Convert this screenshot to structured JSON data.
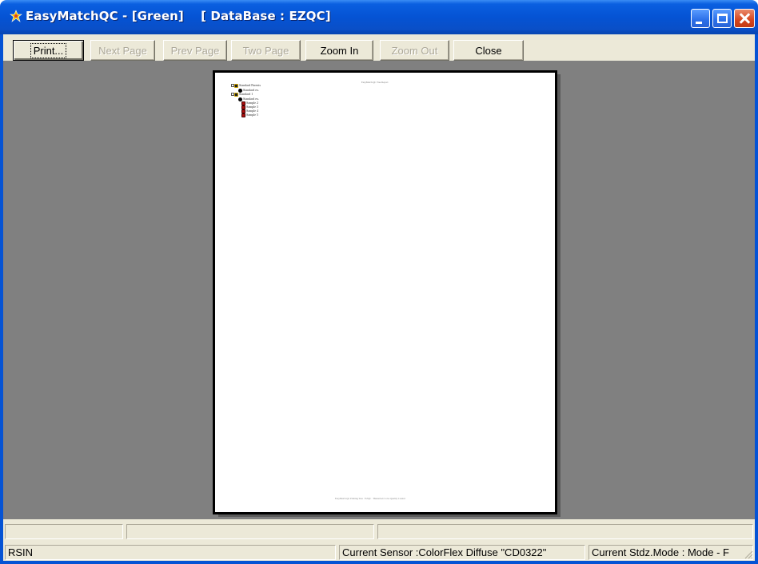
{
  "window": {
    "title": "EasyMatchQC - [Green]    [ DataBase : EZQC]",
    "app_icon": "easymatch-app-icon",
    "controls": {
      "minimize": "minimize-icon",
      "maximize": "maximize-icon",
      "close": "close-icon"
    }
  },
  "toolbar": {
    "buttons": [
      {
        "label": "Print...",
        "enabled": true,
        "focused": true
      },
      {
        "label": "Next Page",
        "enabled": false
      },
      {
        "label": "Prev Page",
        "enabled": false
      },
      {
        "label": "Two Page",
        "enabled": false
      },
      {
        "label": "Zoom In",
        "enabled": true
      },
      {
        "label": "Zoom Out",
        "enabled": false
      },
      {
        "label": "Close",
        "enabled": true
      }
    ]
  },
  "preview": {
    "page": {
      "header": "EasyMatch QC Tree Report",
      "footer": "EasyMatch QC Printing Tree  ·  EZQC  ·  HunterLab Color Quality Control",
      "tree": [
        {
          "label": "Standard Parents",
          "type": "folder"
        },
        {
          "label": "Standard ex.",
          "type": "std"
        },
        {
          "label": "Standard 1",
          "type": "folder"
        },
        {
          "label": "Standard ex.",
          "type": "std"
        },
        {
          "label": "Sample 2",
          "type": "sample"
        },
        {
          "label": "Sample 3",
          "type": "sample"
        },
        {
          "label": "Sample 4",
          "type": "sample"
        },
        {
          "label": "Sample 5",
          "type": "sample"
        }
      ]
    }
  },
  "status": {
    "left": "RSIN",
    "sensor": "Current Sensor :ColorFlex Diffuse \"CD0322\"",
    "stdz_mode": "Current Stdz.Mode :  Mode - F"
  },
  "colors": {
    "titlebar": "#0553d4",
    "chrome": "#ece9d8",
    "preview_bg": "#808080",
    "close_button": "#d6451d"
  }
}
